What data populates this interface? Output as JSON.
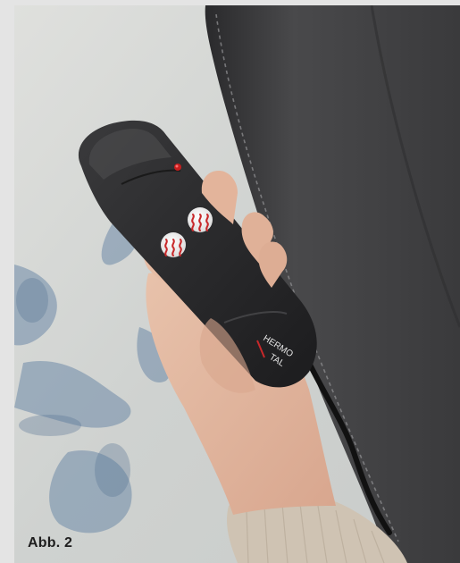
{
  "figure": {
    "caption": "Abb. 2",
    "photo_subject": "hand holding heating remote control next to leather armchair"
  },
  "remote": {
    "brand_top": "HERMO",
    "brand_bottom": "TAL",
    "buttons": [
      {
        "icon": "heat-waves-icon"
      },
      {
        "icon": "heat-waves-icon"
      }
    ],
    "led_color": "#c81e1e",
    "accent_color": "#c8282a"
  }
}
